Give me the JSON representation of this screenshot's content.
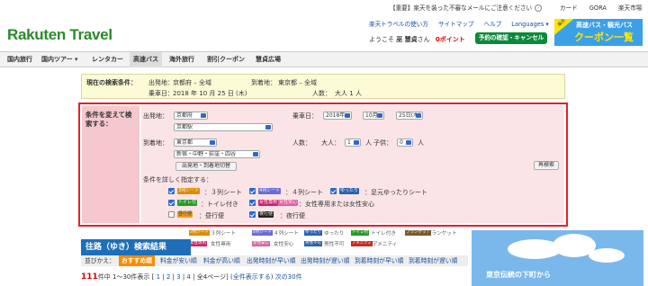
{
  "topbar": {
    "notice": "【重要】楽天を装った不審なメールにご注意ください",
    "links": [
      "カード",
      "GORA",
      "楽天市場"
    ]
  },
  "header": {
    "logo": "Rakuten Travel",
    "links": [
      "楽天トラベルの使い方",
      "サイトマップ",
      "ヘルプ",
      "Languages ▾"
    ],
    "welcome_prefix": "ようこそ",
    "user_name": "巫 慧貞",
    "welcome_suffix": "さん",
    "points": "0ポイント",
    "reservation_button": "予約の確認・キャンセル",
    "banner_line1": "高速バス・観光バス",
    "banner_line2": "クーポン一覧",
    "banner_ribbon": "楽天"
  },
  "nav": {
    "items": [
      "国内旅行",
      "国内ツアー ▾",
      "レンタカー",
      "高速バス",
      "海外旅行",
      "割引クーポン",
      "慧貞広場"
    ],
    "active_index": 3
  },
  "current": {
    "label": "現在の検索条件：",
    "dep_label": "出発地：",
    "dep": "京都府 – 全域",
    "arr_label": "到着地：",
    "arr": "東京都 – 全域",
    "date_label": "乗車日：",
    "date": "2018 年 10 月 25 日 (木)",
    "people_label": "人数：",
    "people": "大人 1 人"
  },
  "form": {
    "side_label": "条件を変えて検索する：",
    "dep_label": "出発地：",
    "dep_pref": "京都府",
    "dep_station": "京都駅",
    "arr_label": "到着地：",
    "arr_pref": "東京都",
    "arr_area": "新宿・中野・荻窪・四谷",
    "swap_button": "出発地・到着地切替",
    "date_label": "乗車日：",
    "year": "2018年",
    "month": "10月",
    "day": "25日(木)",
    "people_label": "人数：",
    "adult_label": "大人：",
    "adult": "1",
    "adult_unit": "人",
    "child_label": "子供：",
    "child": "0",
    "child_unit": "人",
    "search_button": "再検索",
    "detail_label": "条件を詳しく指定する：",
    "options": [
      {
        "tag": "3列シート",
        "text": "：３列シート"
      },
      {
        "tag": "4列シート",
        "text": "：４列シート"
      },
      {
        "tag": "ゆったり",
        "text": "：足元ゆったりシート"
      },
      {
        "tag": "トイレ付",
        "text": "：トイレ付き"
      },
      {
        "tag": "女性専用",
        "tag2": "女性安心",
        "text": "：女性専用または女性安心"
      },
      {
        "tag": "昼行便",
        "text": "：昼行便"
      },
      {
        "tag": "夜行便",
        "text": "：夜行便"
      }
    ]
  },
  "legend": {
    "items": [
      "３列シート",
      "４列シート",
      "ゆったり",
      "トイレ付き",
      "ブランケット",
      "女性専用",
      "女性安心",
      "男性不可",
      "アメニティ"
    ],
    "tags": [
      "3列シート",
      "4列シート",
      "ゆったり",
      "トイレ付",
      "ブランケット",
      "女性専用",
      "女性安心",
      "男性不可",
      "アメニティ"
    ]
  },
  "results": {
    "title": "往路（ゆき）検索結果",
    "sort_label": "並びかえ：",
    "sort_active": "おすすめ順",
    "sort_options": [
      "料金が安い順",
      "料金が高い順",
      "出発時刻が早い順",
      "出発時刻が遅い順",
      "到着時刻が早い順",
      "到着時刻が遅い順"
    ],
    "count": "111",
    "count_suffix": "件中 1〜30件表示 [",
    "pages": [
      "1",
      "2",
      "3",
      "4"
    ],
    "pager_tail": "全4ページ] (",
    "show_all": "全件表示する",
    "pager_close": ")",
    "next": "次の30件"
  },
  "ad": {
    "text": "東京伝統の下町から"
  },
  "colors": {
    "brand": "#2a8a2a",
    "accent": "#e61e2a",
    "nav_bar": "#1e6fb8",
    "sort_active": "#ff8a00"
  }
}
